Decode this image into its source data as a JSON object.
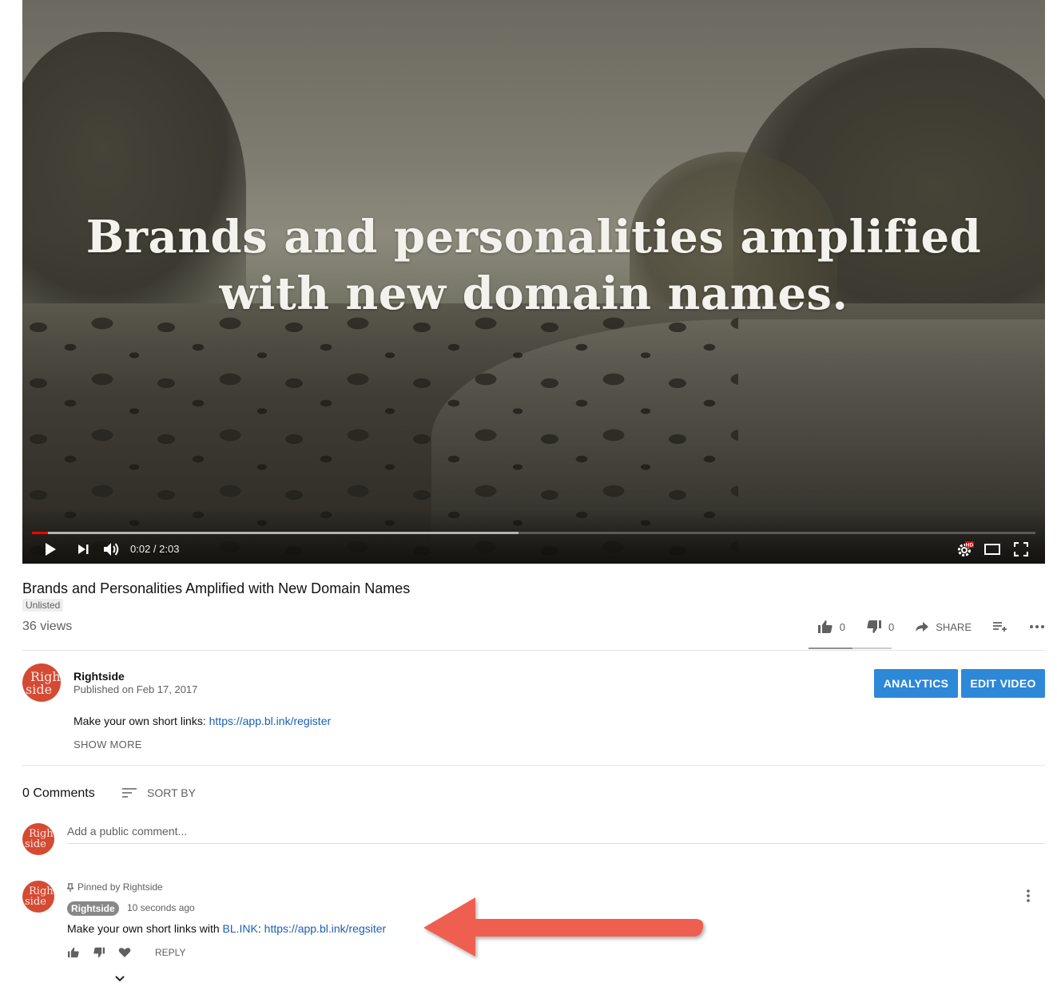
{
  "player": {
    "overlay_line1": "Brands and personalities amplified",
    "overlay_line2": "with new domain names.",
    "time_display": "0:02 / 2:03",
    "progress_played_fraction": 0.016,
    "progress_buffered_fraction": 0.485,
    "hd_badge": "HD"
  },
  "video": {
    "title": "Brands and Personalities Amplified with New Domain Names",
    "privacy_badge": "Unlisted",
    "views": "36 views",
    "likes": "0",
    "dislikes": "0",
    "share_label": "SHARE"
  },
  "channel": {
    "name": "Rightside",
    "published": "Published on Feb 17, 2017",
    "avatar_line1": "Right",
    "avatar_line2": "side",
    "analytics_label": "ANALYTICS",
    "edit_label": "EDIT VIDEO"
  },
  "description": {
    "text": "Make your own short links: ",
    "link": "https://app.bl.ink/register",
    "show_more": "SHOW MORE"
  },
  "comments": {
    "count_label": "0 Comments",
    "sort_label": "SORT BY",
    "placeholder": "Add a public comment...",
    "pinned_label": "Pinned by Rightside",
    "author": "Rightside",
    "time": "10 seconds ago",
    "text_prefix": "Make your own short links with ",
    "brand_link": "BL.INK",
    "text_sep": ": ",
    "url_link": "https://app.bl.ink/regsiter",
    "reply_label": "REPLY"
  },
  "colors": {
    "accent_blue": "#2d88d8",
    "avatar_red": "#d54a33",
    "progress_red": "#ff0000",
    "annotation_arrow": "#ef5f50"
  }
}
